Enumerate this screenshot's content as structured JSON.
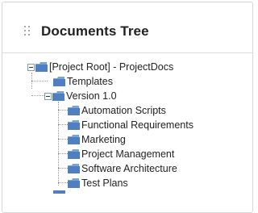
{
  "panel": {
    "title": "Documents Tree"
  },
  "tree": {
    "root": "[Project Root] - ProjectDocs",
    "templates": "Templates",
    "version": "Version 1.0",
    "children": [
      "Automation Scripts",
      "Functional Requirements",
      "Marketing",
      "Project Management",
      "Software Architecture",
      "Test Plans"
    ]
  },
  "icons": {
    "drag": "drag-handle-icon",
    "folder": "folder-icon",
    "collapse": "collapse-toggle-icon"
  },
  "colors": {
    "folder_blue": "#4f7fbf",
    "toggle_border": "#7f9db9"
  }
}
